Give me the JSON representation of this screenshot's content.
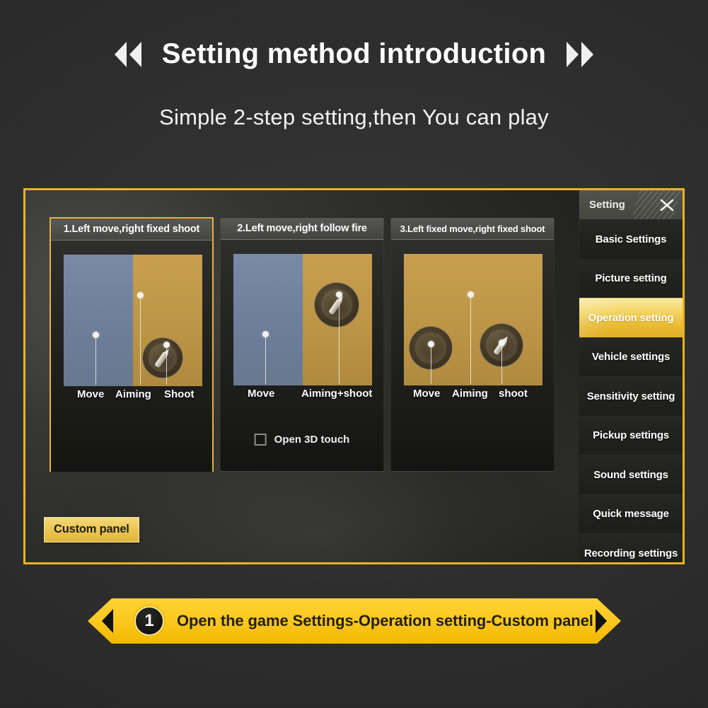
{
  "header": {
    "title": "Setting method introduction",
    "left_icon": "chevron-double-left-icon",
    "right_icon": "chevron-double-right-icon",
    "subtitle": "Simple 2-step setting,then You can play"
  },
  "colors": {
    "accent_gold": "#e8b320",
    "highlight_gold": "#f3d25c",
    "banner_yellow": "#fcc81f",
    "preview_blue": "#6e7e9a",
    "preview_gold": "#bd9546",
    "background": "#2b2b2b"
  },
  "game": {
    "panels": [
      {
        "title": "1.Left move,right fixed shoot",
        "selected": true,
        "preview": "split-blue-gold",
        "labels": [
          "Move",
          "Aiming",
          "Shoot"
        ],
        "has_checkbox": false,
        "joysticks": 1
      },
      {
        "title": "2.Left move,right follow fire",
        "selected": false,
        "preview": "split-blue-gold",
        "labels": [
          "Move",
          "Aiming+shoot"
        ],
        "has_checkbox": true,
        "checkbox_label": "Open 3D touch",
        "checkbox_checked": false,
        "joysticks": 1
      },
      {
        "title": "3.Left fixed move,right fixed shoot",
        "selected": false,
        "preview": "full-gold",
        "labels": [
          "Move",
          "Aiming",
          "shoot"
        ],
        "has_checkbox": false,
        "joysticks": 2
      }
    ],
    "custom_panel_button": "Custom panel",
    "sidebar": {
      "title": "Setting",
      "close_icon": "close-x-icon",
      "items": [
        {
          "label": "Basic Settings",
          "active": false
        },
        {
          "label": "Picture setting",
          "active": false
        },
        {
          "label": "Operation setting",
          "active": true
        },
        {
          "label": "Vehicle settings",
          "active": false
        },
        {
          "label": "Sensitivity setting",
          "active": false
        },
        {
          "label": "Pickup settings",
          "active": false
        },
        {
          "label": "Sound settings",
          "active": false
        },
        {
          "label": "Quick message",
          "active": false
        },
        {
          "label": "Recording settings",
          "active": false
        }
      ]
    }
  },
  "banner": {
    "step_number": "1",
    "text": "Open the game Settings-Operation setting-Custom panel",
    "left_icon": "arrow-left-icon",
    "right_icon": "arrow-right-icon"
  }
}
